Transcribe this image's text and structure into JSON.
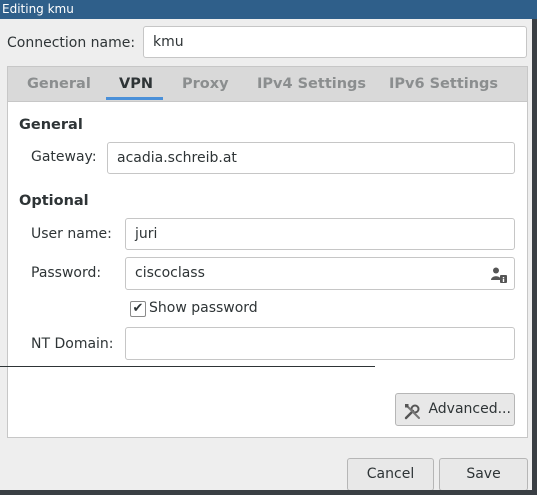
{
  "window": {
    "title": "Editing kmu"
  },
  "connection": {
    "label": "Connection name:",
    "value": "kmu"
  },
  "tabs": [
    {
      "label": "General",
      "active": false
    },
    {
      "label": "VPN",
      "active": true
    },
    {
      "label": "Proxy",
      "active": false
    },
    {
      "label": "IPv4 Settings",
      "active": false
    },
    {
      "label": "IPv6 Settings",
      "active": false
    }
  ],
  "vpn": {
    "general_heading": "General",
    "gateway_label": "Gateway:",
    "gateway_value": "acadia.schreib.at",
    "optional_heading": "Optional",
    "username_label": "User name:",
    "username_value": "juri",
    "password_label": "Password:",
    "password_value": "ciscoclass",
    "password_icon": "user-key-icon",
    "show_password_label": "Show password",
    "show_password_checked": true,
    "nt_domain_label": "NT Domain:",
    "nt_domain_value": "",
    "advanced_label": "Advanced...",
    "advanced_icon": "tools-icon"
  },
  "footer": {
    "cancel_label": "Cancel",
    "save_label": "Save"
  },
  "colors": {
    "titlebar": "#2f5f8a",
    "tab_accent": "#4a90d9"
  }
}
